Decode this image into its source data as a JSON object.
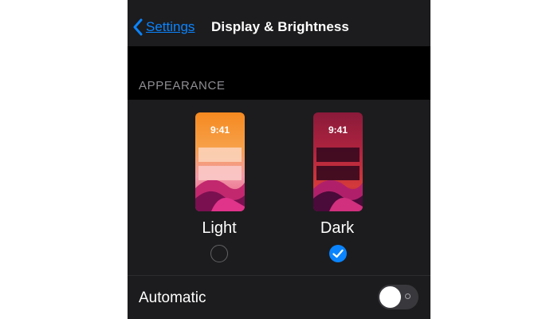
{
  "navbar": {
    "back_label": "Settings",
    "title": "Display & Brightness"
  },
  "appearance": {
    "section_label": "APPEARANCE",
    "options": [
      {
        "label": "Light",
        "preview_time": "9:41",
        "selected": false
      },
      {
        "label": "Dark",
        "preview_time": "9:41",
        "selected": true
      }
    ]
  },
  "automatic": {
    "label": "Automatic",
    "enabled": false
  },
  "colors": {
    "accent": "#0a84ff",
    "background": "#1c1c1e",
    "section_background": "#000000",
    "secondary_text": "#8e8e93"
  },
  "icons": {
    "back": "chevron-left-icon",
    "selected": "checkmark-icon"
  }
}
